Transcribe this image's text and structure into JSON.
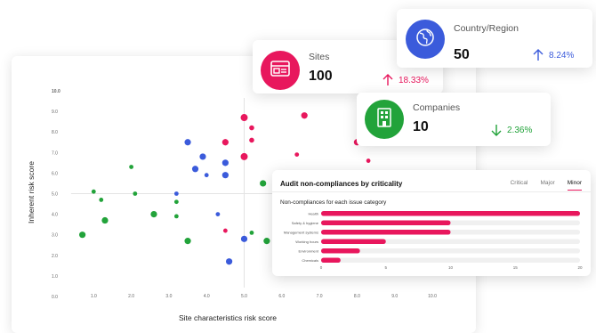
{
  "scatter": {
    "ylabel": "Inherent risk score",
    "xlabel": "Site characteristics risk score",
    "chart_data": {
      "type": "scatter",
      "xlabel": "Site characteristics risk score",
      "ylabel": "Inherent risk score",
      "xlim": [
        0,
        10
      ],
      "ylim": [
        0,
        10
      ],
      "x_ticks": [
        "0.0",
        "1.0",
        "2.0",
        "3.0",
        "4.0",
        "5.0",
        "6.0",
        "7.0",
        "8.0",
        "9.0",
        "10.0"
      ],
      "y_ticks": [
        "0.0",
        "1.0",
        "2.0",
        "3.0",
        "4.0",
        "5.0",
        "6.0",
        "7.0",
        "8.0",
        "9.0",
        "10.0"
      ],
      "threshold_y": 10.0,
      "quadrant_x": 5.0,
      "quadrant_y": 5.0,
      "colors": {
        "high": "#e8175d",
        "medium": "#3b5bdb",
        "low": "#22a33a",
        "threshold_left": "#3b5bdb",
        "threshold_right": "#22a33a"
      },
      "series": [
        {
          "color_key": "high",
          "points": [
            {
              "x": 5.0,
              "y": 8.7,
              "s": 5
            },
            {
              "x": 6.6,
              "y": 8.8,
              "s": 4.5
            },
            {
              "x": 5.2,
              "y": 8.2,
              "s": 3.5
            },
            {
              "x": 4.5,
              "y": 7.5,
              "s": 4.5
            },
            {
              "x": 5.2,
              "y": 7.6,
              "s": 3.5
            },
            {
              "x": 8.0,
              "y": 7.5,
              "s": 4.5
            },
            {
              "x": 5.0,
              "y": 6.8,
              "s": 5
            },
            {
              "x": 6.4,
              "y": 6.9,
              "s": 3
            },
            {
              "x": 8.3,
              "y": 6.6,
              "s": 3
            },
            {
              "x": 4.5,
              "y": 3.2,
              "s": 3
            }
          ]
        },
        {
          "color_key": "medium",
          "points": [
            {
              "x": 3.5,
              "y": 7.5,
              "s": 4.5
            },
            {
              "x": 3.9,
              "y": 6.8,
              "s": 4.5
            },
            {
              "x": 4.5,
              "y": 6.5,
              "s": 4.5
            },
            {
              "x": 3.7,
              "y": 6.2,
              "s": 4.5
            },
            {
              "x": 4.0,
              "y": 5.9,
              "s": 3
            },
            {
              "x": 4.5,
              "y": 5.9,
              "s": 4.5
            },
            {
              "x": 3.2,
              "y": 5.0,
              "s": 3
            },
            {
              "x": 4.3,
              "y": 4.0,
              "s": 3
            },
            {
              "x": 5.0,
              "y": 2.8,
              "s": 4.5
            },
            {
              "x": 4.6,
              "y": 1.7,
              "s": 4.5
            }
          ]
        },
        {
          "color_key": "low",
          "points": [
            {
              "x": 2.0,
              "y": 6.3,
              "s": 3
            },
            {
              "x": 1.0,
              "y": 5.1,
              "s": 3
            },
            {
              "x": 2.1,
              "y": 5.0,
              "s": 3
            },
            {
              "x": 1.2,
              "y": 4.7,
              "s": 3
            },
            {
              "x": 3.2,
              "y": 4.6,
              "s": 3
            },
            {
              "x": 2.6,
              "y": 4.0,
              "s": 4.5
            },
            {
              "x": 3.2,
              "y": 3.9,
              "s": 3
            },
            {
              "x": 1.3,
              "y": 3.7,
              "s": 4.5
            },
            {
              "x": 0.7,
              "y": 3.0,
              "s": 4.5
            },
            {
              "x": 3.5,
              "y": 2.7,
              "s": 4.5
            },
            {
              "x": 5.6,
              "y": 2.7,
              "s": 4.5
            },
            {
              "x": 5.5,
              "y": 5.5,
              "s": 4.5
            },
            {
              "x": 5.2,
              "y": 3.1,
              "s": 3
            }
          ]
        }
      ]
    }
  },
  "kpis": {
    "country": {
      "title": "Country/Region",
      "value": "50",
      "delta": "8.24%",
      "direction": "up",
      "icon": "globe-icon",
      "color": "#3b5bdb"
    },
    "sites": {
      "title": "Sites",
      "value": "100",
      "delta": "18.33%",
      "direction": "up",
      "icon": "browser-window-icon",
      "color": "#e8175d"
    },
    "companies": {
      "title": "Companies",
      "value": "10",
      "delta": "2.36%",
      "direction": "down",
      "icon": "building-icon",
      "color": "#22a33a"
    }
  },
  "audit": {
    "title": "Audit non-compliances by criticality",
    "tabs": [
      "Critical",
      "Major",
      "Minor"
    ],
    "active_tab": "Minor",
    "subtitle": "Non-compliances for each issue category",
    "chart_data": {
      "type": "bar",
      "orientation": "horizontal",
      "categories": [
        "Health",
        "Safety & hygiene",
        "Management systems",
        "Working hours",
        "Environment",
        "Chemicals"
      ],
      "values": [
        20,
        10,
        10,
        5,
        3,
        1.5
      ],
      "xlim": [
        0,
        20
      ],
      "x_ticks": [
        "0",
        "5",
        "10",
        "15",
        "20"
      ],
      "color": "#e8175d",
      "track_color": "#f0f0f0"
    }
  }
}
